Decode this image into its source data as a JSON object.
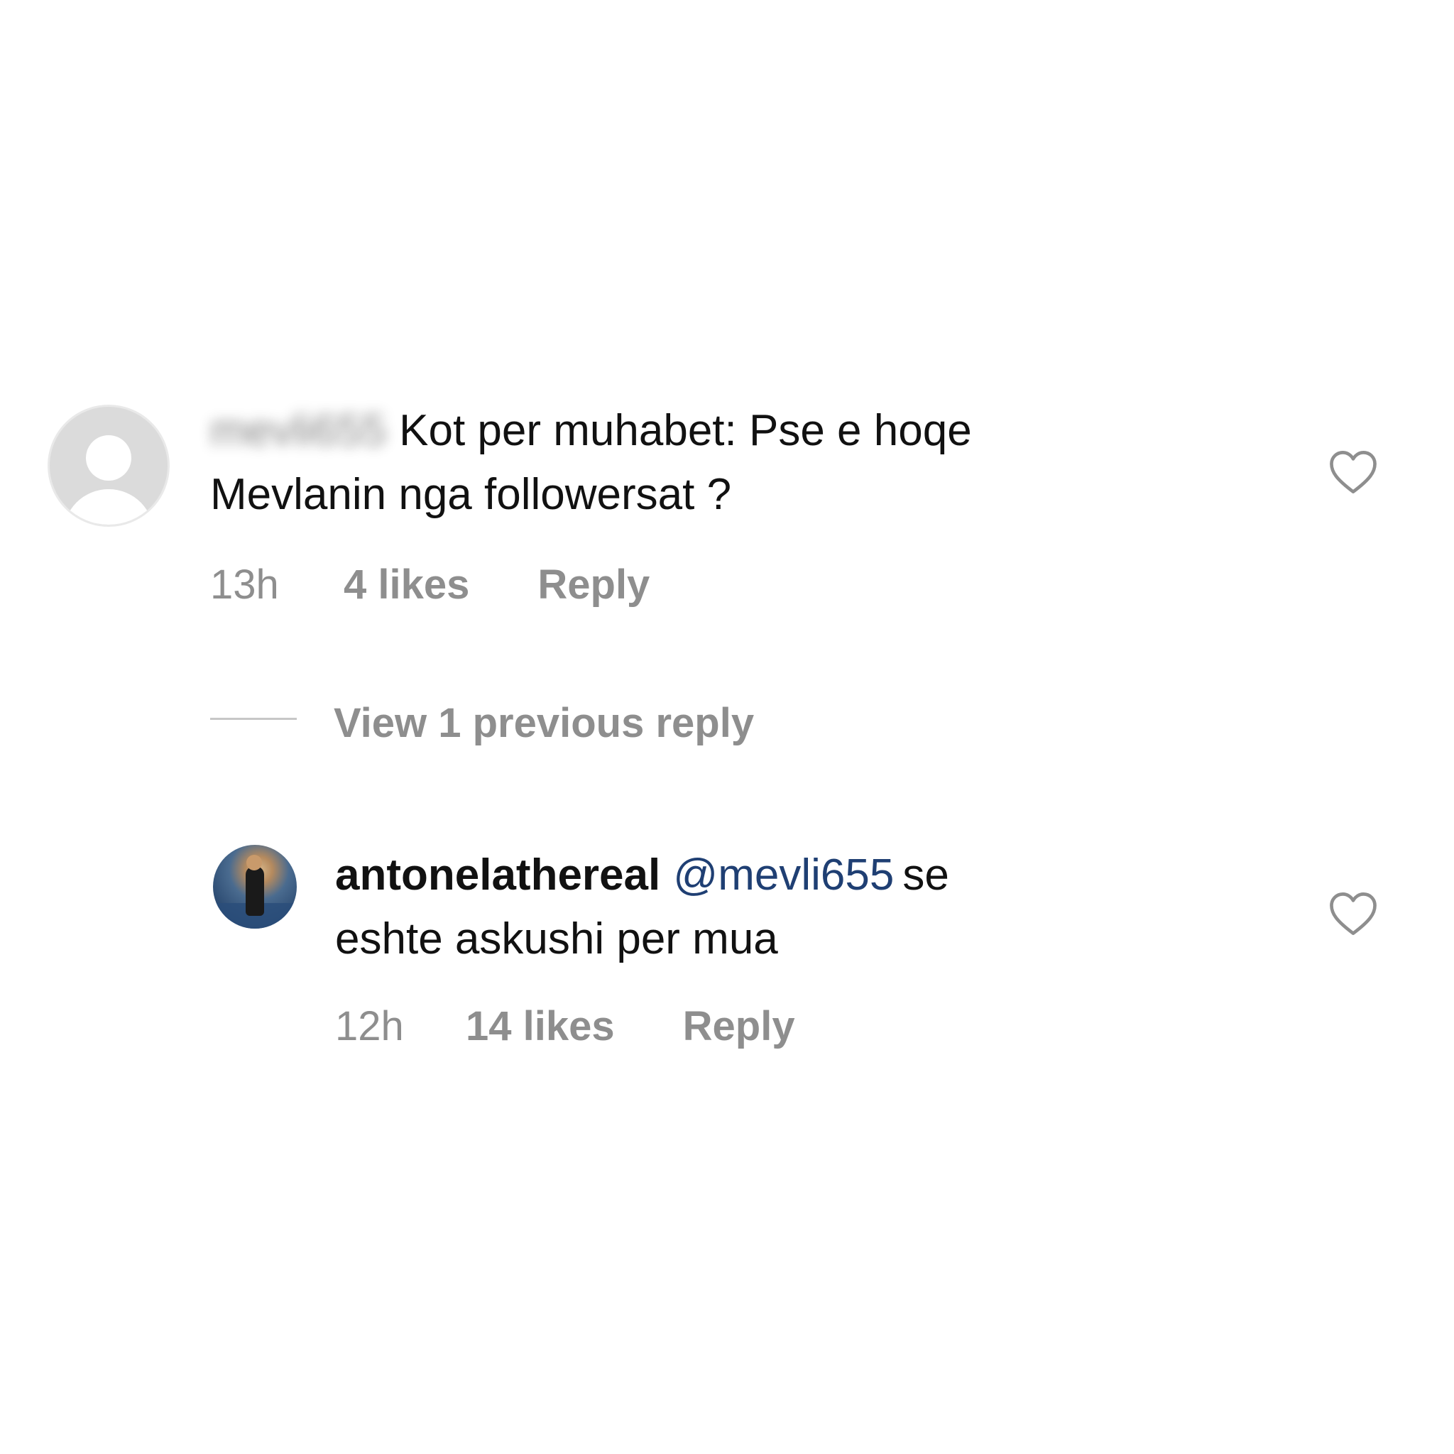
{
  "comments": [
    {
      "username_blurred": "mevli655",
      "text_line1": "Kot per muhabet: Pse e hoqe",
      "text_line2": "Mevlanin nga followersat ?",
      "time": "13h",
      "likes": "4 likes",
      "reply_label": "Reply",
      "avatar": "default-avatar-icon",
      "heart_icon": "heart-outline-icon"
    }
  ],
  "view_replies": {
    "label": "View 1 previous reply"
  },
  "replies": [
    {
      "username": "antonelathereal",
      "mention": "@mevli655",
      "text_line1": "se",
      "text_line2": "eshte askushi per mua",
      "time": "12h",
      "likes": "14 likes",
      "reply_label": "Reply",
      "avatar": "profile-photo",
      "heart_icon": "heart-outline-icon"
    }
  ],
  "colors": {
    "text": "#111111",
    "meta": "#8e8e8e",
    "mention": "#1f3f73",
    "divider": "#c7c7c7"
  }
}
